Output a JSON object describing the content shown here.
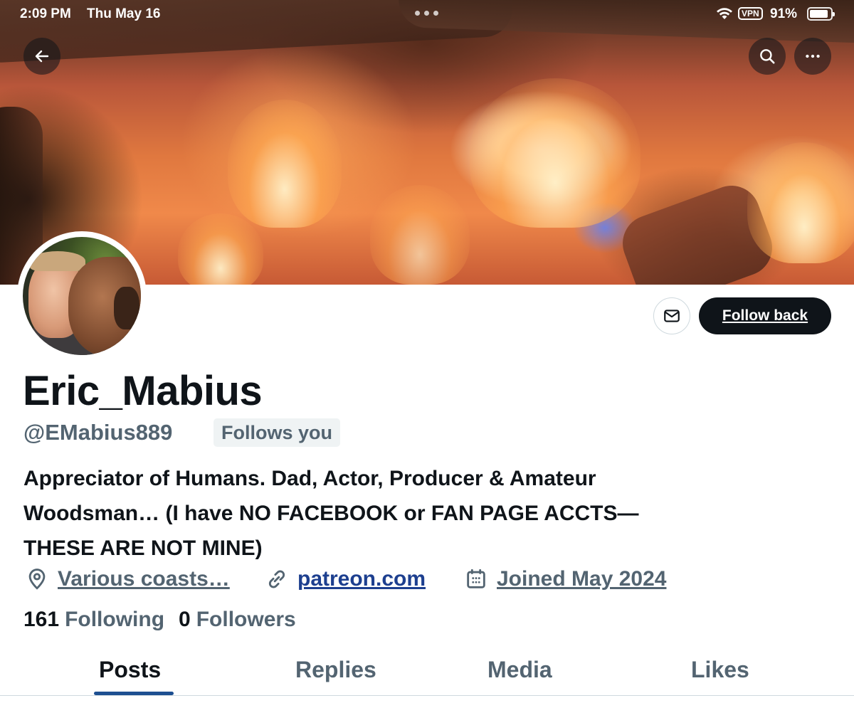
{
  "status_bar": {
    "time": "2:09 PM",
    "date": "Thu May 16",
    "vpn": "VPN",
    "battery": "91%",
    "battery_level": 0.91
  },
  "nav": {
    "back_icon": "arrow-left-icon",
    "search_icon": "search-icon",
    "more_icon": "more-horizontal-icon"
  },
  "profile": {
    "display_name": "Eric_Mabius",
    "handle": "@EMabius889",
    "follows_you": "Follows you",
    "bio_line1": "Appreciator of Humans. Dad, Actor, Producer & Amateur",
    "bio_line2": "Woodsman… (I have NO FACEBOOK or FAN PAGE ACCTS—",
    "bio_line3": "THESE ARE NOT MINE)",
    "location": "Various coasts…",
    "website": "patreon.com",
    "joined": "Joined May 2024"
  },
  "actions": {
    "message_icon": "envelope-icon",
    "follow_back": "Follow back"
  },
  "stats": {
    "following_count": "161",
    "following_label": "Following",
    "followers_count": "0",
    "followers_label": "Followers"
  },
  "tabs": [
    {
      "label": "Posts",
      "active": true
    },
    {
      "label": "Replies",
      "active": false
    },
    {
      "label": "Media",
      "active": false
    },
    {
      "label": "Likes",
      "active": false
    }
  ],
  "colors": {
    "primary_text": "#0f1419",
    "secondary_text": "#536471",
    "link": "#1d3f8f",
    "button_dark": "#0f1419",
    "tab_indicator": "#1d4f91"
  }
}
